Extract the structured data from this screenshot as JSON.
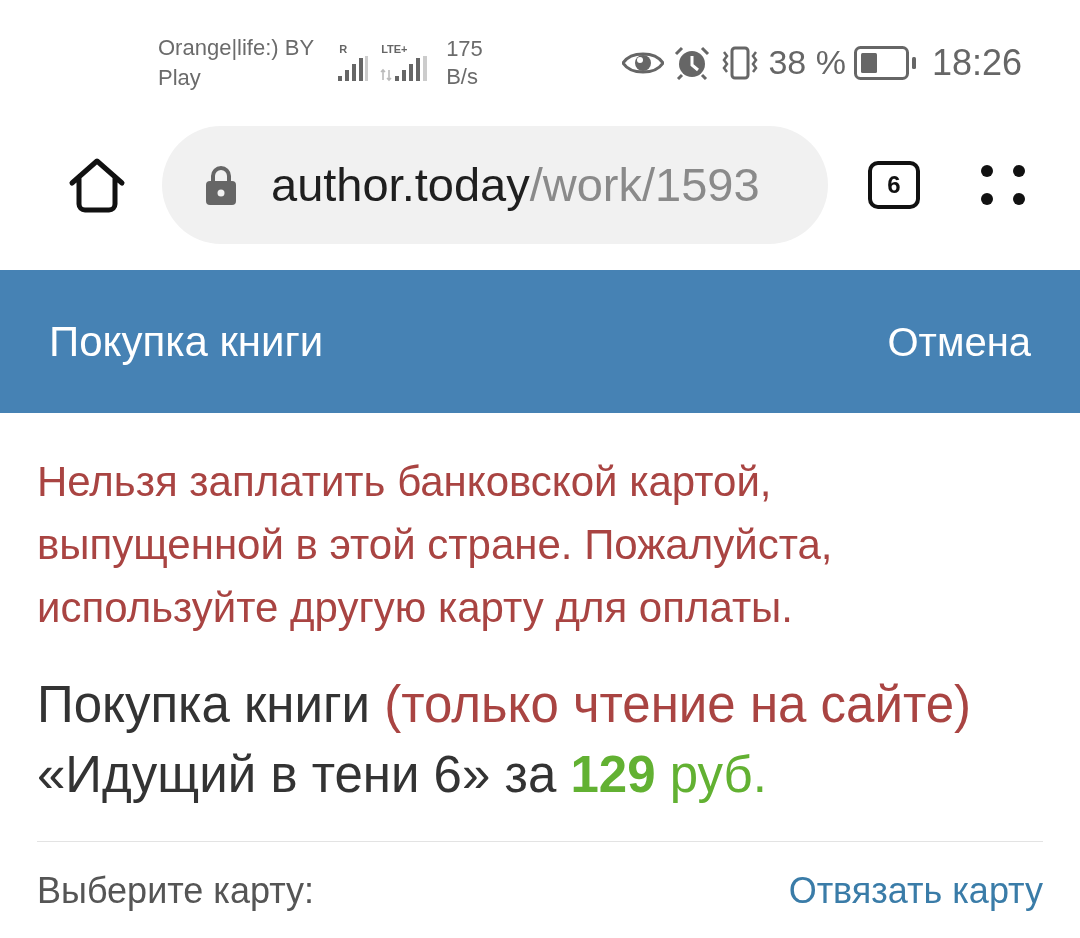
{
  "status_bar": {
    "carrier_lines": [
      "Orange|life:) BY",
      "Play"
    ],
    "signals": [
      {
        "label": "R"
      },
      {
        "label": "LTE+"
      }
    ],
    "speed_lines": [
      "175",
      "B/s"
    ],
    "battery_percent": "38 %",
    "time": "18:26"
  },
  "browser_bar": {
    "url": {
      "host": "author.today",
      "path": "/work/1593"
    },
    "tab_count": "6"
  },
  "header": {
    "title": "Покупка книги",
    "cancel": "Отмена"
  },
  "error_message": "Нельзя заплатить банковской картой, выпущенной в этой стране. Пожалуйста, используйте другую карту для оплаты.",
  "purchase_heading": {
    "lines": [
      [
        {
          "kind": "plain",
          "text": "Покупка книги "
        },
        {
          "kind": "note",
          "text": "(только чтение на сайте)"
        }
      ],
      [
        {
          "kind": "plain",
          "text": "«Идущий в тени 6» за "
        },
        {
          "kind": "price",
          "text": "129"
        },
        {
          "kind": "currency",
          "text": " руб."
        }
      ]
    ]
  },
  "card_section": {
    "label": "Выберите карту:",
    "unlink": "Отвязать карту"
  }
}
